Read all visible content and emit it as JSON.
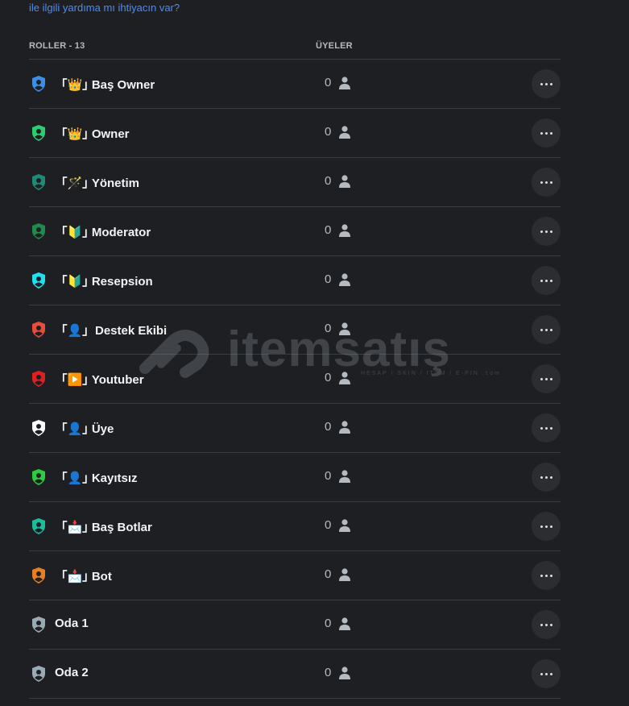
{
  "help_text": "ile ilgili yardıma mı ihtiyacın var?",
  "header": {
    "roles_label": "ROLLER - 13",
    "members_label": "ÜYELER"
  },
  "roles": [
    {
      "name": "｢👑｣ Baş Owner",
      "color": "#3b8fe8",
      "members": "0"
    },
    {
      "name": "｢👑｣ Owner",
      "color": "#2ecc71",
      "members": "0"
    },
    {
      "name": "｢🪄｣ Yönetim",
      "color": "#1f8b74",
      "members": "0"
    },
    {
      "name": "｢🔰｣ Moderator",
      "color": "#1f8b4c",
      "members": "0"
    },
    {
      "name": "｢🔰｣ Resepsion",
      "color": "#1ee0f0",
      "members": "0"
    },
    {
      "name": "｢👤｣  Destek Ekibi",
      "color": "#e74c3c",
      "members": "0"
    },
    {
      "name": "｢▶️｣ Youtuber",
      "color": "#e02020",
      "members": "0"
    },
    {
      "name": "｢👤｣ Üye",
      "color": "#ffffff",
      "members": "0"
    },
    {
      "name": "｢👤｣ Kayıtsız",
      "color": "#2ecc40",
      "members": "0"
    },
    {
      "name": "｢📩｣ Baş Botlar",
      "color": "#1abc9c",
      "members": "0"
    },
    {
      "name": "｢📩｣ Bot",
      "color": "#e67e22",
      "members": "0"
    },
    {
      "name": "Oda 1",
      "color": "#99aab5",
      "members": "0"
    },
    {
      "name": "Oda 2",
      "color": "#99aab5",
      "members": "0"
    }
  ],
  "watermark": {
    "text": "itemsatış",
    "subtext": "HESAP / SKIN / ITEM / E-PIN .com"
  }
}
